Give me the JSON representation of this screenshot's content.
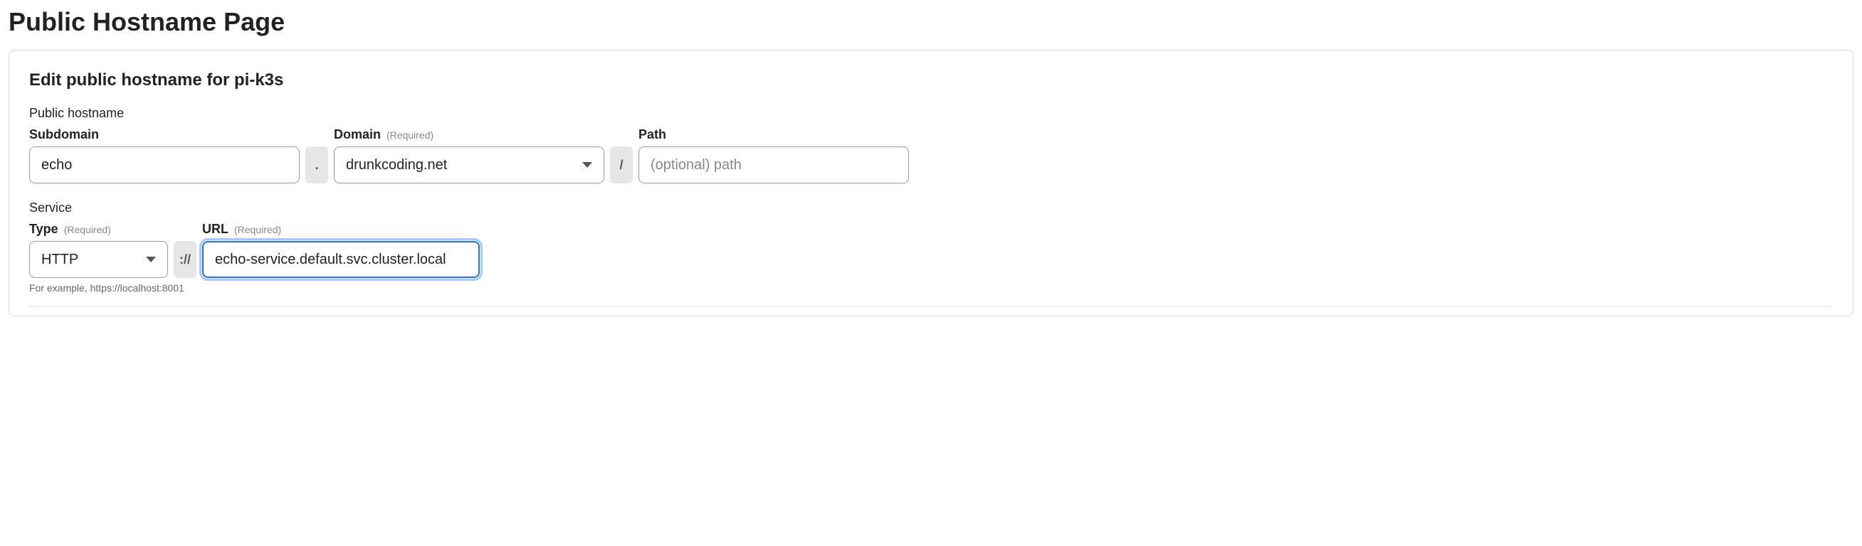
{
  "page_title": "Public Hostname Page",
  "card_title": "Edit public hostname for pi-k3s",
  "public_hostname": {
    "section_label": "Public hostname",
    "subdomain": {
      "label": "Subdomain",
      "value": "echo"
    },
    "domain": {
      "label": "Domain",
      "required_text": "(Required)",
      "value": "drunkcoding.net"
    },
    "path": {
      "label": "Path",
      "placeholder": "(optional) path",
      "value": ""
    },
    "dot_sep": ".",
    "slash_sep": "/"
  },
  "service": {
    "section_label": "Service",
    "type": {
      "label": "Type",
      "required_text": "(Required)",
      "value": "HTTP"
    },
    "scheme_sep": "://",
    "url": {
      "label": "URL",
      "required_text": "(Required)",
      "value": "echo-service.default.svc.cluster.local"
    },
    "example_text": "For example, https://localhost:8001"
  }
}
